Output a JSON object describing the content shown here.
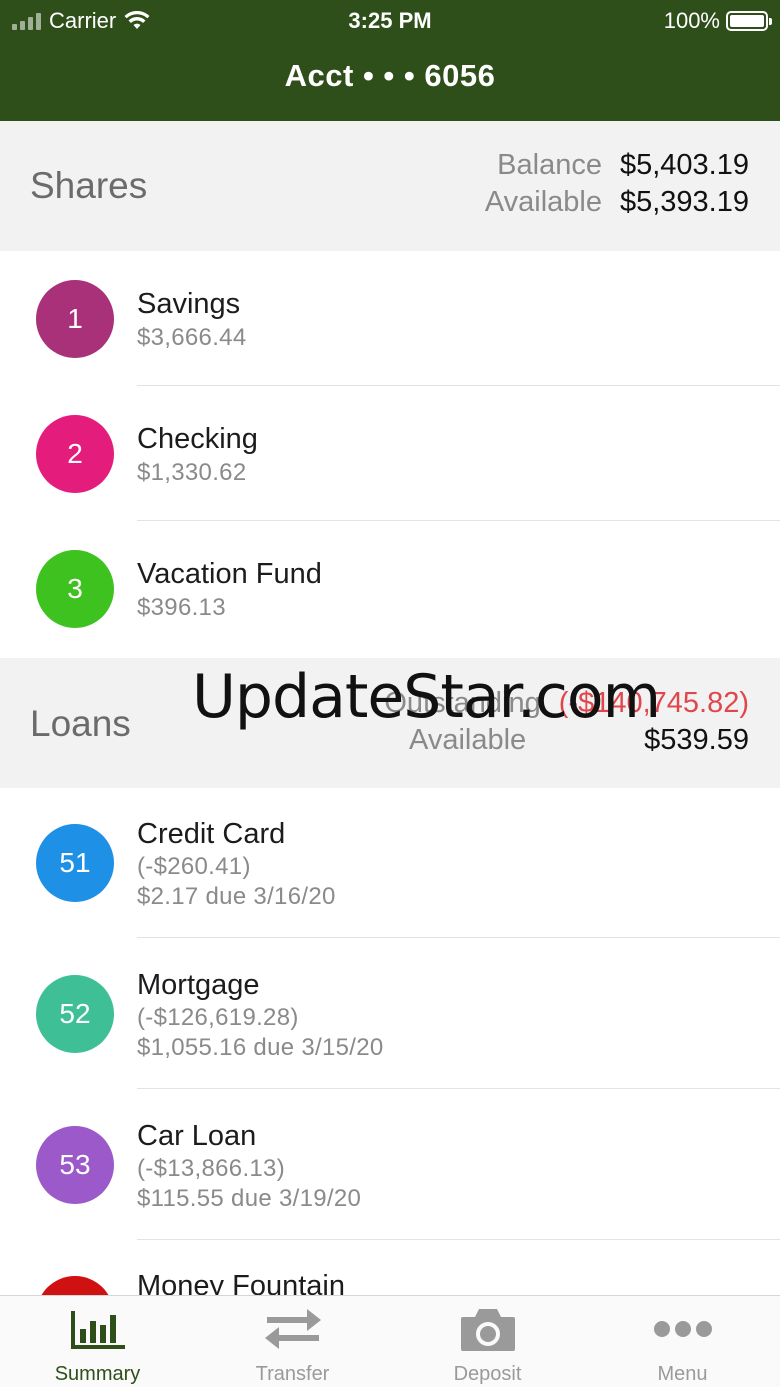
{
  "status_bar": {
    "carrier": "Carrier",
    "time": "3:25 PM",
    "battery": "100%"
  },
  "header": {
    "title": "Acct • • • 6056"
  },
  "shares": {
    "title": "Shares",
    "balance_label": "Balance",
    "balance_value": "$5,403.19",
    "available_label": "Available",
    "available_value": "$5,393.19",
    "items": [
      {
        "number": "1",
        "name": "Savings",
        "amount": "$3,666.44",
        "color": "#a8317a"
      },
      {
        "number": "2",
        "name": "Checking",
        "amount": "$1,330.62",
        "color": "#e41c7c"
      },
      {
        "number": "3",
        "name": "Vacation Fund",
        "amount": "$396.13",
        "color": "#3ec21f"
      }
    ]
  },
  "loans": {
    "title": "Loans",
    "outstanding_label": "Outstanding",
    "outstanding_value": "(-$140,745.82)",
    "available_label": "Available",
    "available_value": "$539.59",
    "items": [
      {
        "number": "51",
        "name": "Credit Card",
        "balance": "(-$260.41)",
        "due": "$2.17 due 3/16/20",
        "color": "#1e90e6"
      },
      {
        "number": "52",
        "name": "Mortgage",
        "balance": "(-$126,619.28)",
        "due": "$1,055.16 due 3/15/20",
        "color": "#3fbf95"
      },
      {
        "number": "53",
        "name": "Car Loan",
        "balance": "(-$13,866.13)",
        "due": "$115.55 due 3/19/20",
        "color": "#9b59c9"
      },
      {
        "number": "",
        "name": "Money Fountain",
        "color": "#d01111"
      }
    ]
  },
  "watermark": "UpdateStar.com",
  "tabs": [
    {
      "label": "Summary",
      "icon": "bar-chart-icon",
      "active": true
    },
    {
      "label": "Transfer",
      "icon": "transfer-arrows-icon",
      "active": false
    },
    {
      "label": "Deposit",
      "icon": "camera-icon",
      "active": false
    },
    {
      "label": "Menu",
      "icon": "more-dots-icon",
      "active": false
    }
  ],
  "colors": {
    "brand": "#2f4f1a",
    "negative": "#e0474c",
    "section_bg": "#f2f2f2"
  }
}
